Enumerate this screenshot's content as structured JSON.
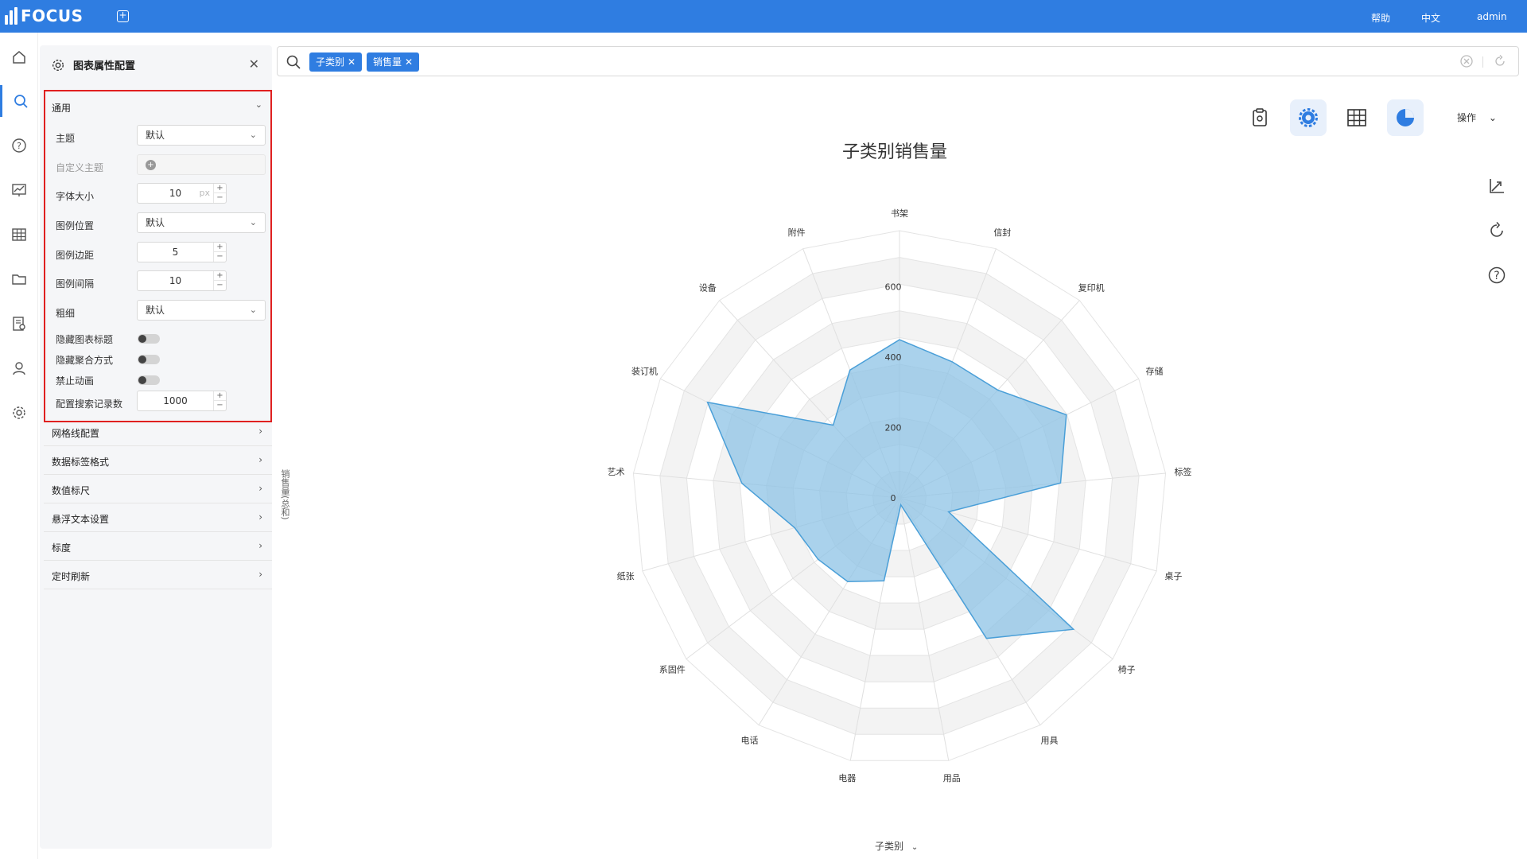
{
  "app": {
    "logo_text": "FOCUS",
    "help": "帮助",
    "language": "中文",
    "user": "admin"
  },
  "panel": {
    "title": "图表属性配置",
    "general": {
      "title": "通用",
      "theme_label": "主题",
      "theme_value": "默认",
      "custom_theme_label": "自定义主题",
      "font_size_label": "字体大小",
      "font_size_value": "10",
      "font_size_unit": "px",
      "legend_position_label": "图例位置",
      "legend_position_value": "默认",
      "legend_margin_label": "图例边距",
      "legend_margin_value": "5",
      "legend_spacing_label": "图例间隔",
      "legend_spacing_value": "10",
      "thickness_label": "粗细",
      "thickness_value": "默认",
      "hide_title_label": "隐藏图表标题",
      "hide_aggregation_label": "隐藏聚合方式",
      "disable_animation_label": "禁止动画",
      "search_records_label": "配置搜索记录数",
      "search_records_value": "1000"
    },
    "sections": [
      "网格线配置",
      "数据标签格式",
      "数值标尺",
      "悬浮文本设置",
      "标度",
      "定时刷新"
    ]
  },
  "search": {
    "chips": [
      "子类别",
      "销售量"
    ]
  },
  "toolbar": {
    "ops_label": "操作"
  },
  "chart_data": {
    "type": "radar",
    "title": "子类别销售量",
    "categories": [
      "书架",
      "信封",
      "复印机",
      "存储",
      "标签",
      "桌子",
      "椅子",
      "用具",
      "用品",
      "电器",
      "电话",
      "系固件",
      "纸张",
      "艺术",
      "装订机",
      "设备",
      "附件"
    ],
    "series": [
      {
        "name": "销售量(总和)",
        "values": [
          450,
          415,
          415,
          530,
          460,
          145,
          620,
          470,
          20,
          240,
          280,
          290,
          310,
          450,
          610,
          280,
          390
        ]
      }
    ],
    "rings": [
      0,
      200,
      400,
      600
    ],
    "rmax": 760,
    "ylabel": "销售量(总和)",
    "xlabel": "子类别",
    "colors": {
      "fill": "#8ec3e6",
      "stroke": "#4a9fd8"
    }
  }
}
